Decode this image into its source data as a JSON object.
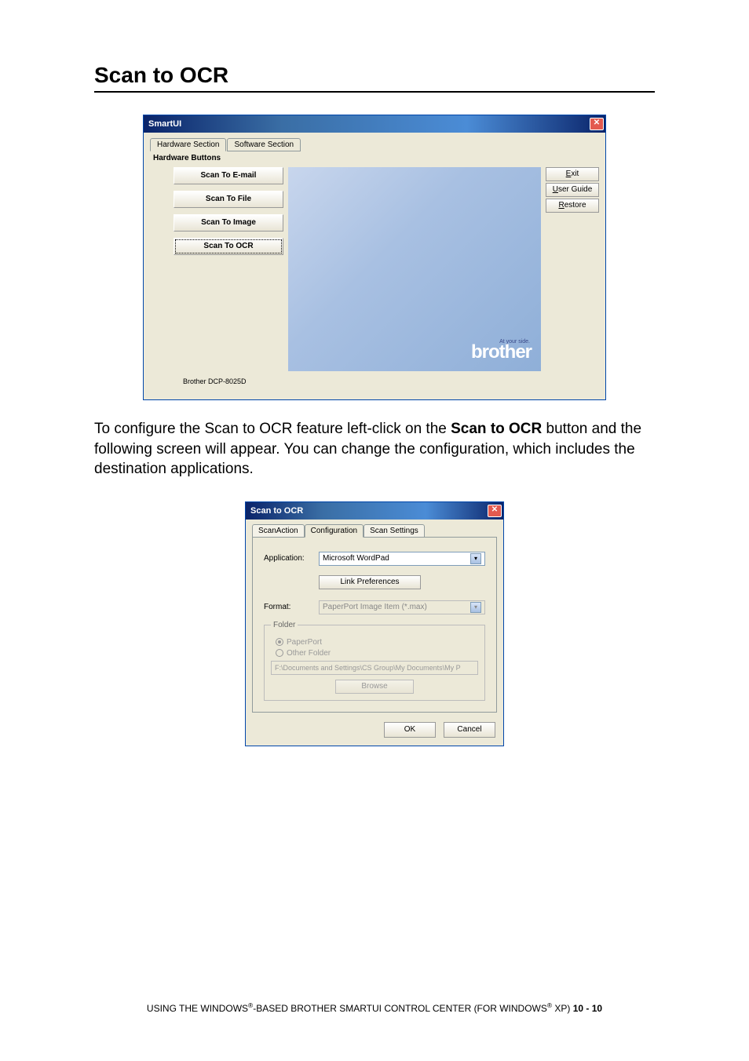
{
  "page": {
    "heading": "Scan to OCR",
    "body_prefix": "To configure the Scan to OCR feature left-click on the ",
    "body_bold": "Scan to OCR",
    "body_suffix": " button and the following screen will appear. You can change the configuration, which includes the destination applications.",
    "footer_prefix": "USING THE WINDOWS",
    "footer_mid": "-BASED BROTHER SMARTUI CONTROL CENTER (FOR WINDOWS",
    "footer_suffix": " XP)  ",
    "footer_page": "10 - 10"
  },
  "smartui": {
    "title": "SmartUI",
    "tabs": {
      "hw": "Hardware Section",
      "sw": "Software Section"
    },
    "hw_label": "Hardware Buttons",
    "buttons": {
      "email": "Scan To E-mail",
      "file": "Scan To File",
      "image": "Scan To Image",
      "ocr": "Scan To OCR"
    },
    "side": {
      "exit": "Exit",
      "guide": "User Guide",
      "restore": "Restore",
      "exit_u": "E",
      "guide_u": "U",
      "restore_u": "R"
    },
    "model": "Brother DCP-8025D",
    "brand": "brother",
    "brand_sub": "At your side."
  },
  "ocr": {
    "title": "Scan to OCR",
    "tabs": {
      "action": "ScanAction",
      "config": "Configuration",
      "settings": "Scan Settings"
    },
    "app_label": "Application:",
    "app_value": "Microsoft WordPad",
    "link_pref": "Link Preferences",
    "format_label": "Format:",
    "format_value": "PaperPort Image Item (*.max)",
    "folder_legend": "Folder",
    "radio_paperport": "PaperPort",
    "radio_other": "Other Folder",
    "path": "F:\\Documents and Settings\\CS Group\\My Documents\\My P",
    "browse": "Browse",
    "ok": "OK",
    "cancel": "Cancel"
  }
}
